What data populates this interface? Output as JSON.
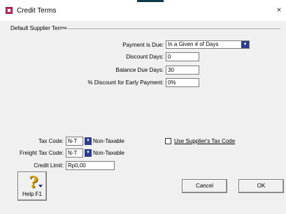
{
  "window": {
    "title": "Credit Terms",
    "close_symbol": "×"
  },
  "group": {
    "label": "Default Supplier Terms"
  },
  "payment_is_due": {
    "label": "Payment is Due:",
    "value": "In a Given # of Days"
  },
  "discount_days": {
    "label": "Discount Days:",
    "value": "0"
  },
  "balance_due_days": {
    "label": "Balance Due Days:",
    "value": "30"
  },
  "early_payment_discount": {
    "label": "% Discount for Early Payment:",
    "value": "0%"
  },
  "tax_code": {
    "label": "Tax Code:",
    "value": "N-T",
    "description": "Non-Taxable"
  },
  "use_supplier_tax_code": {
    "label_prefix": "",
    "label_underlined": "Use Supplier's Tax Code",
    "checked": false
  },
  "freight_tax_code": {
    "label": "Freight Tax Code:",
    "value": "N-T",
    "description": "Non-Taxable"
  },
  "credit_limit": {
    "label": "Credit Limit:",
    "value": "Rp0,00"
  },
  "buttons": {
    "cancel": "Cancel",
    "ok": "OK",
    "help": "Help F1"
  },
  "icons": {
    "app": "credit-terms-app-icon",
    "close": "close-icon",
    "dropdown": "dropdown-arrow-icon",
    "help": "question-mark-icon"
  }
}
